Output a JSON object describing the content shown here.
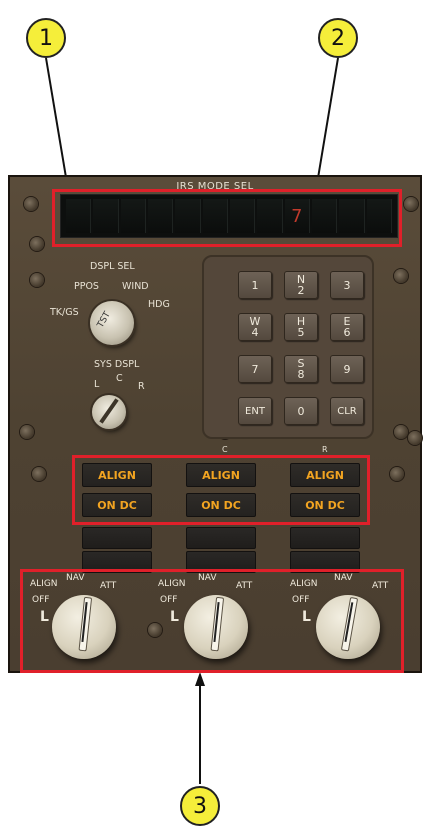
{
  "callouts": [
    "1",
    "2",
    "3"
  ],
  "panel": {
    "title": "IRS MODE SEL",
    "display_digits": [
      "",
      "",
      "",
      "",
      "",
      "",
      "",
      "",
      "7",
      "",
      "",
      ""
    ],
    "dspl_sel": {
      "label": "DSPL  SEL",
      "positions": [
        "TK/GS",
        "PPOS",
        "WIND",
        "HDG"
      ],
      "knob_marking": "TST"
    },
    "sys_dspl": {
      "label": "SYS  DSPL",
      "positions": [
        "L",
        "C",
        "R"
      ]
    },
    "keypad": {
      "keys": [
        {
          "top": "1",
          "bottom": ""
        },
        {
          "top": "N",
          "bottom": "2"
        },
        {
          "top": "3",
          "bottom": ""
        },
        {
          "top": "W",
          "bottom": "4"
        },
        {
          "top": "H",
          "bottom": "5"
        },
        {
          "top": "E",
          "bottom": "6"
        },
        {
          "top": "7",
          "bottom": ""
        },
        {
          "top": "S",
          "bottom": "8"
        },
        {
          "top": "9",
          "bottom": ""
        },
        {
          "top": "ENT",
          "bottom": ""
        },
        {
          "top": "0",
          "bottom": ""
        },
        {
          "top": "CLR",
          "bottom": ""
        }
      ]
    },
    "irs_labels": [
      "C",
      "R"
    ],
    "annunciators": [
      {
        "align": "ALIGN",
        "on_dc": "ON DC"
      },
      {
        "align": "ALIGN",
        "on_dc": "ON DC"
      },
      {
        "align": "ALIGN",
        "on_dc": "ON DC"
      }
    ],
    "mode_selectors": [
      {
        "align": "ALIGN",
        "nav": "NAV",
        "att": "ATT",
        "off": "OFF",
        "side": "L"
      },
      {
        "align": "ALIGN",
        "nav": "NAV",
        "att": "ATT",
        "off": "OFF",
        "side": "L"
      },
      {
        "align": "ALIGN",
        "nav": "NAV",
        "att": "ATT",
        "off": "OFF",
        "side": "L"
      }
    ]
  },
  "colors": {
    "callout_fill": "#f5ee3a",
    "highlight_box": "#e0202a",
    "annunciator_text": "#f2a421",
    "display_digit": "#c23a2c"
  }
}
